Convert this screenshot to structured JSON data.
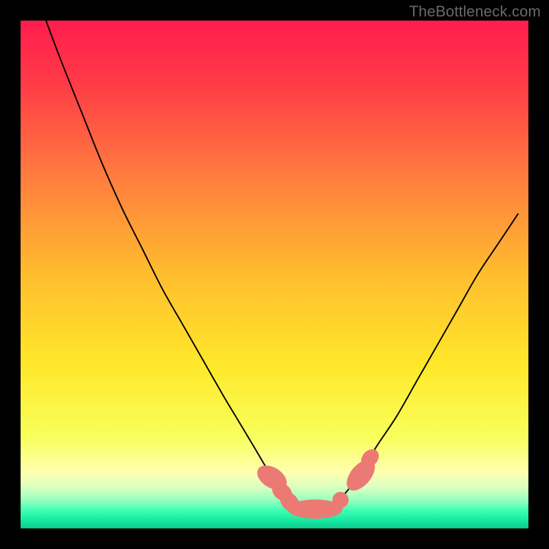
{
  "watermark": "TheBottleneck.com",
  "colors": {
    "curve_stroke": "#000000",
    "marker_fill": "#ec7a74",
    "marker_stroke": "#d66a64",
    "gradient_stops": [
      {
        "offset": 0.0,
        "color": "#ff1d4e"
      },
      {
        "offset": 0.12,
        "color": "#ff3a47"
      },
      {
        "offset": 0.3,
        "color": "#ff7a3f"
      },
      {
        "offset": 0.5,
        "color": "#ffbd2e"
      },
      {
        "offset": 0.68,
        "color": "#ffe82a"
      },
      {
        "offset": 0.82,
        "color": "#f8ff5c"
      },
      {
        "offset": 0.89,
        "color": "#ffffb0"
      },
      {
        "offset": 0.92,
        "color": "#d8ffc0"
      },
      {
        "offset": 0.945,
        "color": "#94ffbf"
      },
      {
        "offset": 0.965,
        "color": "#3dffb4"
      },
      {
        "offset": 0.985,
        "color": "#14e8a0"
      },
      {
        "offset": 1.0,
        "color": "#0dc98c"
      }
    ]
  },
  "chart_data": {
    "type": "line",
    "title": "",
    "xlabel": "",
    "ylabel": "",
    "xlim": [
      0,
      100
    ],
    "ylim": [
      0,
      100
    ],
    "legend": false,
    "grid": false,
    "series": [
      {
        "name": "curve",
        "x": [
          5,
          8,
          12,
          16,
          20,
          24,
          28,
          32,
          36,
          40,
          43,
          46,
          49,
          52,
          54,
          56,
          58,
          60,
          62,
          64,
          67,
          70,
          74,
          78,
          82,
          86,
          90,
          94,
          98
        ],
        "y": [
          100,
          92,
          82,
          72,
          63,
          55,
          47,
          40,
          33,
          26,
          21,
          16,
          11,
          7,
          5,
          4,
          4,
          4,
          5,
          7,
          11,
          16,
          22,
          29,
          36,
          43,
          50,
          56,
          62
        ]
      }
    ],
    "markers": [
      {
        "x": 49.5,
        "y": 10,
        "rx": 2.0,
        "ry": 3.2,
        "angle": -58
      },
      {
        "x": 51.5,
        "y": 7.2,
        "rx": 1.6,
        "ry": 2.2,
        "angle": -50
      },
      {
        "x": 53.0,
        "y": 5.2,
        "rx": 1.6,
        "ry": 2.4,
        "angle": -40
      },
      {
        "x": 58.0,
        "y": 3.8,
        "rx": 5.4,
        "ry": 1.9,
        "angle": 0
      },
      {
        "x": 63.0,
        "y": 5.6,
        "rx": 1.6,
        "ry": 1.6,
        "angle": 0
      },
      {
        "x": 67.0,
        "y": 10.5,
        "rx": 2.0,
        "ry": 3.6,
        "angle": 40
      },
      {
        "x": 68.8,
        "y": 13.8,
        "rx": 1.5,
        "ry": 2.0,
        "angle": 42
      }
    ],
    "annotations": []
  }
}
